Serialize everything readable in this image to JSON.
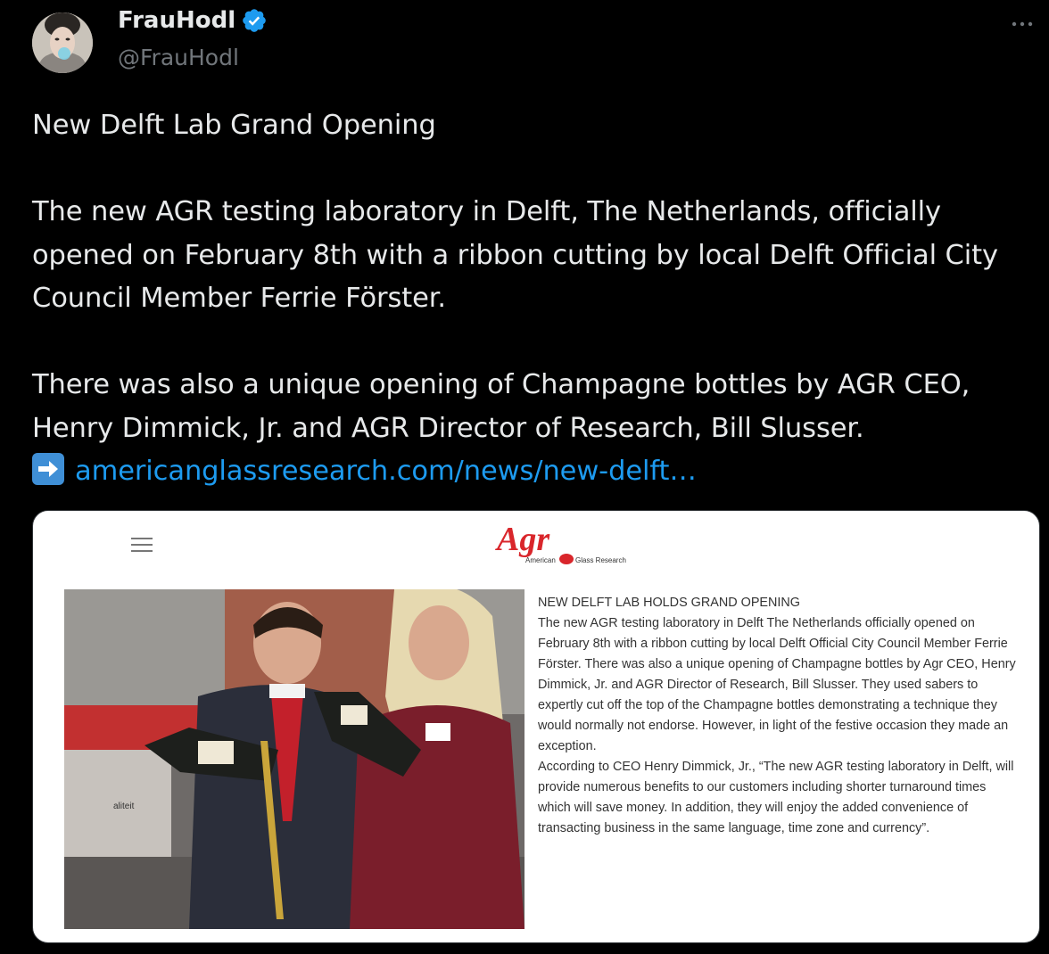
{
  "author": {
    "name": "FrauHodl",
    "handle": "@FrauHodl",
    "verified": true,
    "avatar_icon": "avatar-portrait-bubblegum"
  },
  "more_icon": "more-horizontal-icon",
  "tweet": {
    "line1": "New Delft Lab Grand Opening",
    "para2": "The new AGR testing laboratory in Delft, The Netherlands, officially opened on February 8th with a ribbon cutting by local Delft Official City Council Member Ferrie Förster.",
    "para3": "There was also a unique opening of Champagne bottles by AGR CEO, Henry Dimmick, Jr.  and AGR Director of Research, Bill Slusser.",
    "arrow_icon": "right-arrow-emoji",
    "link": "americanglassresearch.com/news/new-delft…"
  },
  "card": {
    "logo_text": "Agr",
    "logo_sub_left": "American",
    "logo_sub_right": "Glass Research",
    "photo_sign_text": "aliteit",
    "article_title": "NEW DELFT LAB HOLDS GRAND OPENING",
    "article_p1": "The new AGR testing laboratory in Delft The Netherlands officially opened on February 8th with a ribbon cutting by local Delft Official City Council Member Ferrie Förster. There was also a unique opening of Champagne bottles by Agr CEO, Henry Dimmick, Jr.  and AGR Director of Research, Bill Slusser. They used sabers to expertly cut off the top of the Champagne bottles demonstrating a technique they would normally not endorse. However, in light of the festive occasion they made an exception.",
    "article_p2": "According to CEO Henry Dimmick, Jr., “The new AGR testing laboratory in Delft, will provide numerous benefits to our customers including shorter turnaround times which will save money. In addition, they will enjoy the added convenience of transacting business in the same language, time zone and currency”."
  },
  "colors": {
    "background": "#000000",
    "text": "#e7e9ea",
    "muted": "#71767b",
    "link": "#1d9bf0",
    "verified": "#1d9bf0",
    "logo_red": "#d9262b"
  }
}
